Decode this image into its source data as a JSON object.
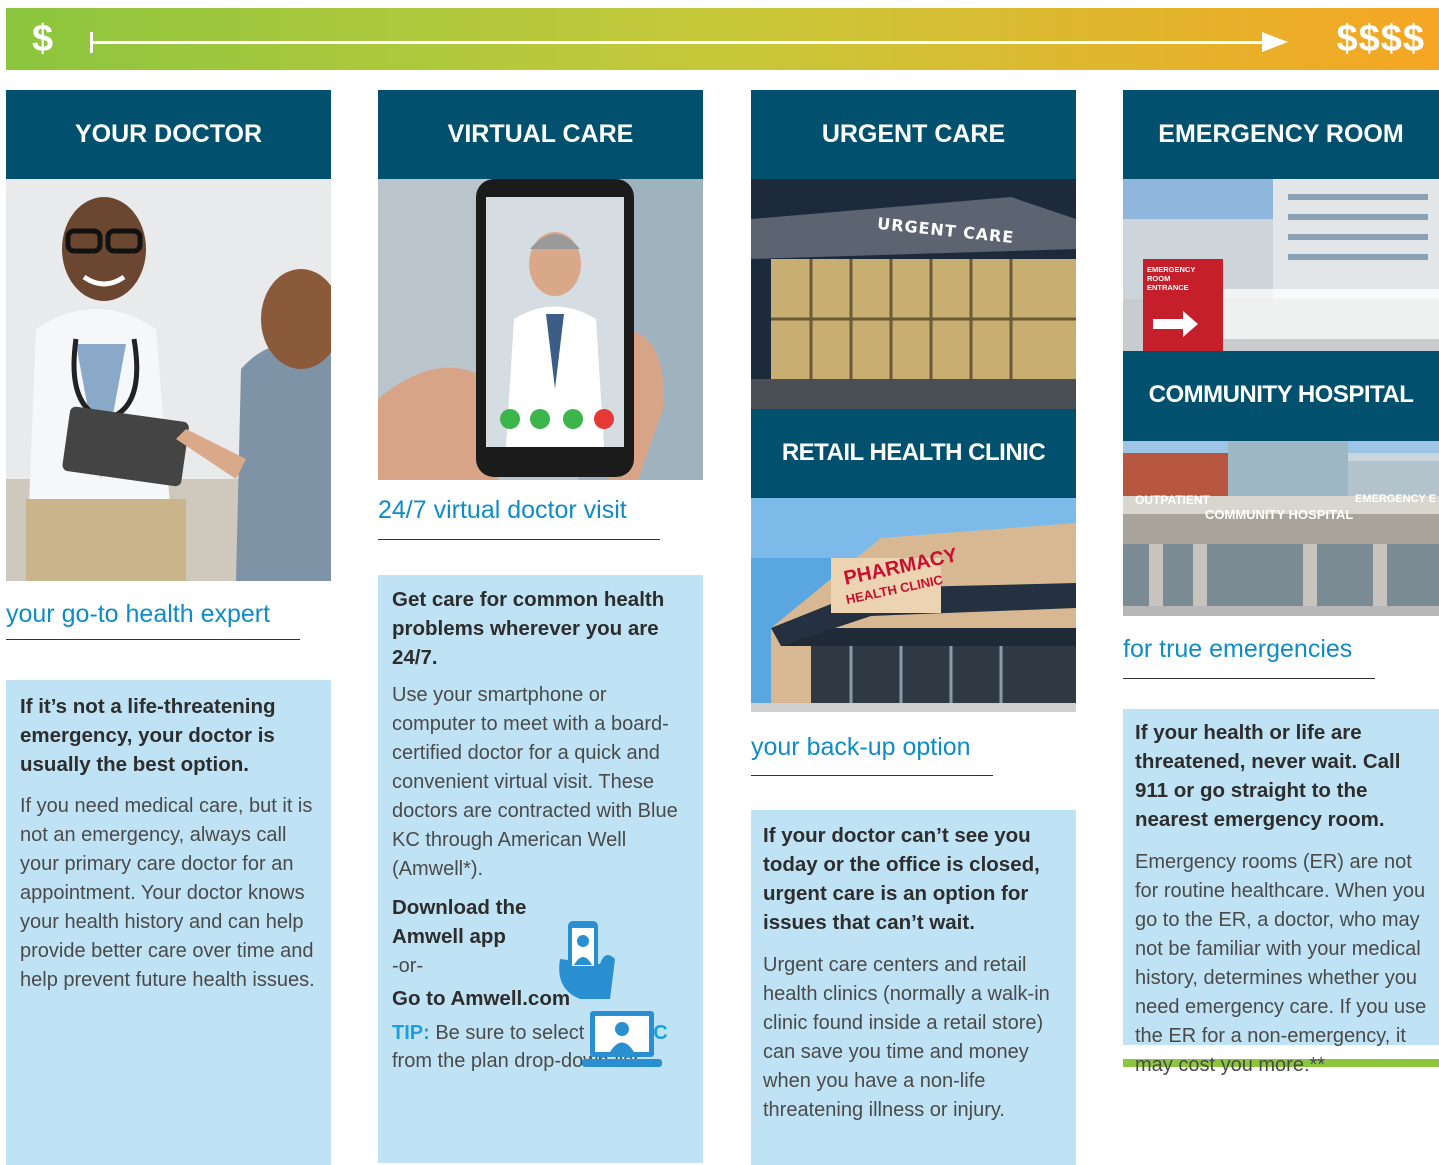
{
  "cost_scale": {
    "low": "$",
    "high": "$$$$"
  },
  "colors": {
    "header_bg": "#00506e",
    "box_bg": "#bfe3f4",
    "accent_blue": "#0f8cc8",
    "green": "#8cc63f",
    "orange": "#f5a623"
  },
  "columns": [
    {
      "header": "YOUR DOCTOR",
      "tagline": "your go-to health expert",
      "lead": "If it’s not a life-threatening emergency, your doctor is usually the best option.",
      "body": "If you need medical care, but it is not an emergency, always call your primary care doctor for an appointment. Your doctor knows your health history and can help provide better care over time and help prevent future health issues."
    },
    {
      "header": "VIRTUAL CARE",
      "tagline": "24/7 virtual doctor visit",
      "lead": "Get care for common health problems wherever you are 24/7.",
      "body": "Use your smartphone or computer to meet with a board-certified doctor for a quick and convenient virtual visit. These doctors are contracted with Blue KC through American Well (Amwell*).",
      "download": "Download the Amwell app",
      "or": "-or-",
      "goto": "Go to Amwell.com",
      "tip_label": "TIP:",
      "tip_text_1": " Be sure to select ",
      "tip_highlight": "Blue KC",
      "tip_text_2": " from the plan drop-down list."
    },
    {
      "header": "URGENT CARE",
      "sign_text": "URGENT CARE",
      "header2": "RETAIL HEALTH CLINIC",
      "clinic_sign_1": "PHARMACY",
      "clinic_sign_2": "HEALTH CLINIC",
      "tagline": "your back-up option",
      "lead": "If your doctor can’t see you today or the office is closed, urgent care is an option for issues that can’t wait.",
      "body": "Urgent care centers and retail health clinics (normally a walk-in clinic found inside a retail store) can save you time and money when you have a non-life threatening illness or injury."
    },
    {
      "header": "EMERGENCY ROOM",
      "er_sign": "EMERGENCY ROOM ENTRANCE",
      "header2": "COMMUNITY HOSPITAL",
      "hospital_sign": "COMMUNITY HOSPITAL",
      "outpatient_sign": "OUTPATIENT",
      "emergency_sign": "EMERGENCY E",
      "tagline": "for true emergencies",
      "lead": "If your health or life are threatened, never wait. Call 911 or go straight to the nearest emergency room.",
      "body": "Emergency rooms (ER) are not for routine healthcare. When you go to the ER, a doctor, who may not be familiar with your medical history, determines whether you need emergency care. If you use the ER for a non-emergency, it may cost you more.**"
    }
  ]
}
